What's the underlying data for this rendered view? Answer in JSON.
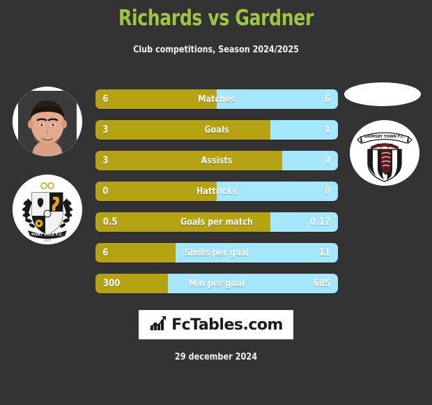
{
  "header": {
    "title": "Richards vs Gardner",
    "subtitle": "Club competitions, Season 2024/2025",
    "title_color": "#9dc741"
  },
  "colors": {
    "background": "#333333",
    "home_bar": "#b5a313",
    "away_bar": "#a5e8fb",
    "text": "#ffffff"
  },
  "home": {
    "player_name": "Richards",
    "club_name": "PORT VALE F.C.",
    "club_founded": "1876",
    "photo": "player-portrait"
  },
  "away": {
    "player_name": "Gardner",
    "club_name": "GRIMSBY TOWN F.C.",
    "photo": "player-portrait"
  },
  "stats": [
    {
      "label": "Matches",
      "home": "6",
      "away": "6",
      "home_pct": 50
    },
    {
      "label": "Goals",
      "home": "3",
      "away": "1",
      "home_pct": 72
    },
    {
      "label": "Assists",
      "home": "3",
      "away": "0",
      "home_pct": 77
    },
    {
      "label": "Hattricks",
      "home": "0",
      "away": "0",
      "home_pct": 50
    },
    {
      "label": "Goals per match",
      "home": "0.5",
      "away": "0.17",
      "home_pct": 72
    },
    {
      "label": "Shots per goal",
      "home": "6",
      "away": "11",
      "home_pct": 33
    },
    {
      "label": "Min per goal",
      "home": "300",
      "away": "685",
      "home_pct": 30
    }
  ],
  "footer": {
    "logo_text": "FcTables.com",
    "logo_icon": "bar-chart-growth-icon",
    "date": "29 december 2024"
  }
}
